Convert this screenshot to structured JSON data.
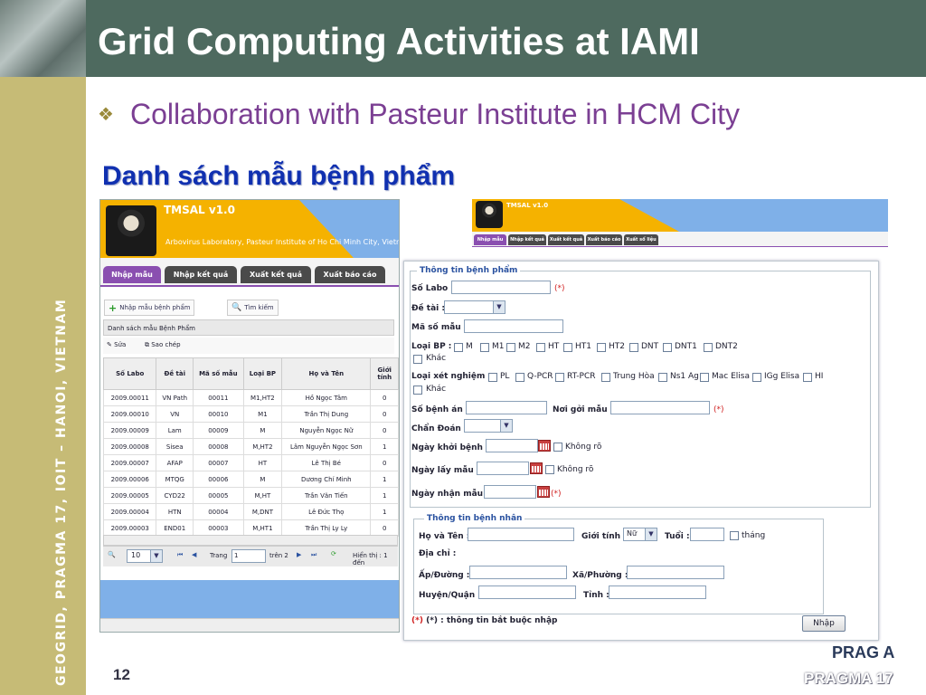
{
  "slide": {
    "title": "Grid Computing Activities at IAMI",
    "subtitle": "Collaboration with Pasteur Institute in HCM City",
    "bullet": "❖",
    "section_heading": "Danh sách mẫu bệnh phẩm",
    "side_text": "GEOGRID, PRAGMA 17, IOIT – HANOI, VIETNAM",
    "page_number": "12",
    "logo_text": "PRAG A",
    "logo_footer": "PRAGMA 17"
  },
  "app": {
    "title": "TMSAL v1.0",
    "subtitle": "Arbovirus Laboratory, Pasteur Institute of Ho Chi Minh City, Vietnam.",
    "tabs": [
      "Nhập mẫu",
      "Nhập kết quả",
      "Xuất kết quả",
      "Xuất báo cáo"
    ],
    "tabs2": [
      "Nhập mẫu",
      "Nhập kết quả",
      "Xuất kết quả",
      "Xuất báo cáo",
      "Xuất sổ liệu"
    ],
    "toolbar": {
      "add": "Nhập mẫu bệnh phẩm",
      "search": "Tìm kiếm"
    },
    "panel_title": "Danh sách mẫu Bệnh Phẩm",
    "edit": "Sửa",
    "copy": "Sao chép",
    "columns": [
      "Số Labo",
      "Đề tài",
      "Mã số mẫu",
      "Loại BP",
      "Họ và Tên",
      "Giới tính"
    ],
    "rows": [
      [
        "2009.00011",
        "VN Path",
        "00011",
        "M1,HT2",
        "Hồ Ngọc Tâm",
        "0"
      ],
      [
        "2009.00010",
        "VN",
        "00010",
        "M1",
        "Trần Thị Dung",
        "0"
      ],
      [
        "2009.00009",
        "Lam",
        "00009",
        "M",
        "Nguyễn Ngọc Nữ",
        "0"
      ],
      [
        "2009.00008",
        "Sisea",
        "00008",
        "M,HT2",
        "Lâm Nguyễn Ngọc Sơn",
        "1"
      ],
      [
        "2009.00007",
        "AFAP",
        "00007",
        "HT",
        "Lê Thị Bé",
        "0"
      ],
      [
        "2009.00006",
        "MTQG",
        "00006",
        "M",
        "Dương Chí Minh",
        "1"
      ],
      [
        "2009.00005",
        "CYD22",
        "00005",
        "M,HT",
        "Trần Văn Tiến",
        "1"
      ],
      [
        "2009.00004",
        "HTN",
        "00004",
        "M,DNT",
        "Lê Đức Thọ",
        "1"
      ],
      [
        "2009.00003",
        "END01",
        "00003",
        "M,HT1",
        "Trần Thị Ly Ly",
        "0"
      ]
    ],
    "pager": {
      "page_size": "10",
      "page_label": "Trang",
      "page": "1",
      "of": "trên 2",
      "showing": "Hiển thị : 1 đến"
    }
  },
  "form": {
    "legend_specimen": "Thông tin bệnh phẩm",
    "so_labo": "Số Labo :",
    "de_tai": "Đề tài :",
    "ma_so_mau": "Mã số mẫu :",
    "loai_bp": "Loại BP :",
    "loai_bp_options": [
      "M",
      "M1",
      "M2",
      "HT",
      "HT1",
      "HT2",
      "DNT",
      "DNT1",
      "DNT2"
    ],
    "khac": "Khác",
    "loai_xn": "Loại xét nghiệm :",
    "loai_xn_options": [
      "PL",
      "Q-PCR",
      "RT-PCR",
      "Trung Hòa",
      "Ns1 Ag",
      "Mac Elisa",
      "IGg Elisa",
      "HI"
    ],
    "so_benh_an": "Số bệnh án :",
    "noi_goi_mau": "Nơi gởi mẫu :",
    "chan_doan": "Chẩn Đoán :",
    "ngay_khoi_benh": "Ngày khởi bệnh :",
    "khong_ro": "Không rõ",
    "ngay_lay_mau": "Ngày lấy mẫu :",
    "ngay_nhan_mau": "Ngày nhận mẫu :",
    "required_mark": "(*)",
    "legend_patient": "Thông tin bệnh nhân",
    "ho_va_ten": "Họ và Tên :",
    "gioi_tinh": "Giới tính :",
    "gioi_tinh_value": "Nữ",
    "tuoi": "Tuổi :",
    "thang": "tháng",
    "dia_chi": "Địa chỉ :",
    "ap_duong": "Ấp/Đường :",
    "xa_phuong": "Xã/Phường :",
    "huyen_quan": "Huyện/Quận :",
    "tinh": "Tỉnh :",
    "footnote": "(*) : thông tin bắt buộc nhập",
    "submit": "Nhập"
  },
  "colors": {
    "title_bar": "#4e6a5f",
    "strip": "#c6bb76",
    "header_orange": "#f5b200",
    "tab_active": "#8a4fb0",
    "heading_blue": "#1030b0"
  }
}
